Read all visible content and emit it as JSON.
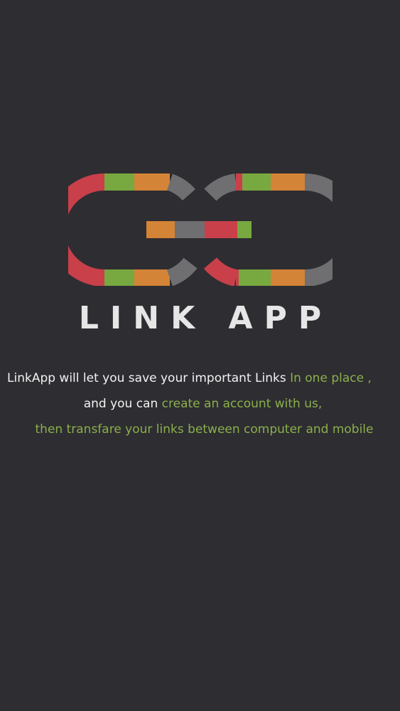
{
  "app": {
    "name": "LINK APP"
  },
  "colors": {
    "background": "#2e2d32",
    "text": "#f2f2f2",
    "highlight": "#8ab04a",
    "title": "#e6e6e6",
    "logo_red": "#c9404a",
    "logo_green": "#78a840",
    "logo_orange": "#d48436",
    "logo_gray": "#6f6f71"
  },
  "logo": {
    "icon": "interlinked-chain-link-icon"
  },
  "intro": {
    "line1_text": "LinkApp will let you save your important Links ",
    "line1_highlight": "In one place ,",
    "line2_text": "and you can ",
    "line2_highlight": "create an account with us,",
    "line3_highlight": "then transfare your links between computer and mobile"
  }
}
